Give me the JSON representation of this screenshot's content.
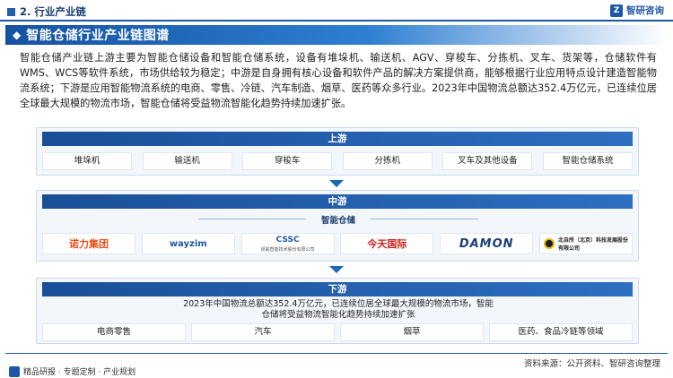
{
  "header": {
    "section": "2. 行业产业链",
    "brand": "智研咨询",
    "brand_logo_glyph": "Z"
  },
  "title": "智能仓储行业产业链图谱",
  "intro": "智能仓储产业链上游主要为智能仓储设备和智能仓储系统，设备有堆垛机、输送机、AGV、穿梭车、分拣机、叉车、货架等，仓储软件有WMS、WCS等软件系统，市场供给较为稳定；中游是自身拥有核心设备和软件产品的解决方案提供商，能够根据行业应用特点设计建造智能物流系统；下游是应用智能物流系统的电商、零售、冷链、汽车制造、烟草、医药等众多行业。2023年中国物流总额达352.4万亿元，已连续位居全球最大规模的物流市场，智能仓储将受益物流智能化趋势持续加速扩张。",
  "upstream": {
    "title": "上游",
    "items": [
      "堆垛机",
      "输送机",
      "穿梭车",
      "分拣机",
      "叉车及其他设备",
      "智能仓储系统"
    ]
  },
  "midstream": {
    "title": "中游",
    "subtitle": "智能仓储",
    "logos": [
      {
        "text": "诺力集团",
        "sub": "NOBLELIFT GROUP",
        "name": "nuoli-logo"
      },
      {
        "text": "wayzim",
        "sub": "",
        "name": "wayzim-logo"
      },
      {
        "text": "CSSC",
        "sub": "昆船智能技术股份有限公司",
        "name": "cssc-logo"
      },
      {
        "text": "今天国际",
        "sub": "",
        "name": "jintian-logo"
      },
      {
        "text": "DAMON",
        "sub": "",
        "name": "damon-logo"
      },
      {
        "text": "北自所（北京）科技发展股份有限公司",
        "sub": "",
        "name": "beijing-logo"
      }
    ]
  },
  "downstream": {
    "title": "下游",
    "text_line1": "2023年中国物流总额达352.4万亿元，已连续位居全球最大规模的物流市场，智能",
    "text_line2": "仓储将受益物流智能化趋势持续加速扩张",
    "items": [
      "电商零售",
      "汽车",
      "烟草",
      "医药、食品冷链等领域"
    ]
  },
  "footer": {
    "left": "精品研报 · 专题定制 · 产业规划",
    "right": "资料来源：公开资料、智研咨询整理"
  },
  "colors": {
    "primary": "#1d57a5",
    "panel_bg": "#f3f7fc"
  }
}
